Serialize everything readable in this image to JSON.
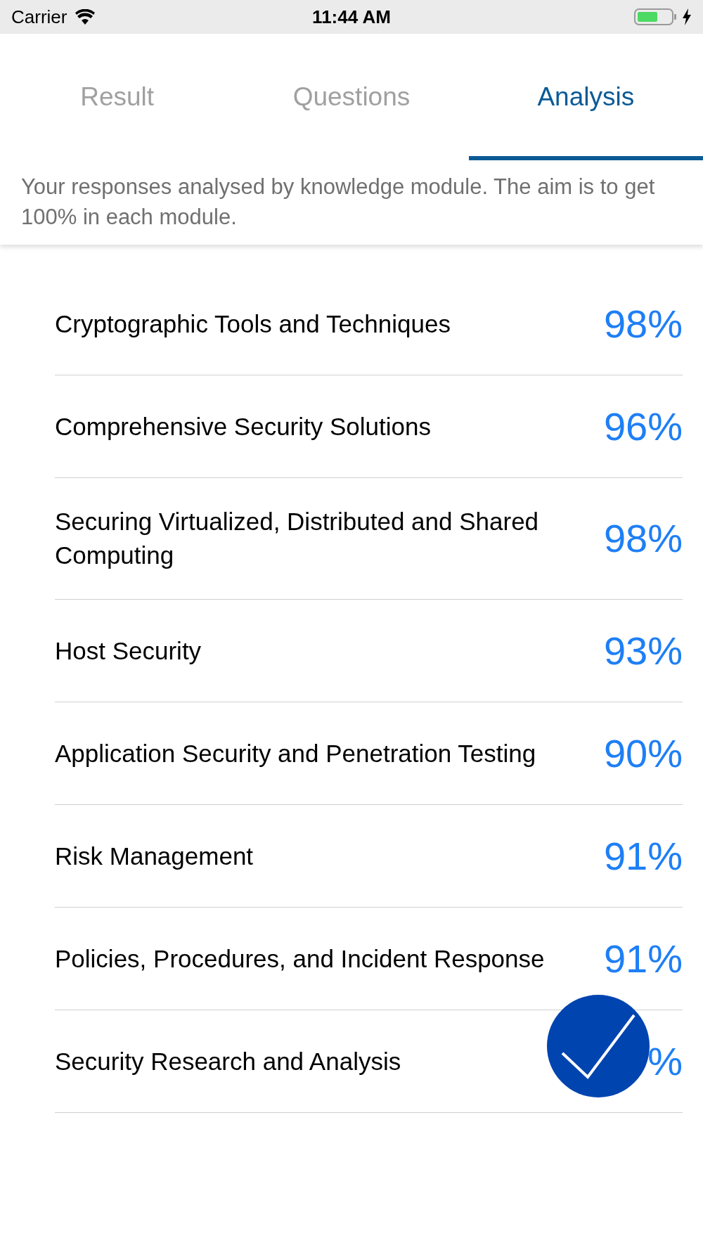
{
  "status_bar": {
    "carrier": "Carrier",
    "time": "11:44 AM"
  },
  "tabs": [
    {
      "label": "Result",
      "selected": false
    },
    {
      "label": "Questions",
      "selected": false
    },
    {
      "label": "Analysis",
      "selected": true
    }
  ],
  "description": "Your responses analysed by knowledge module. The aim is to get 100% in each module.",
  "modules": [
    {
      "name": "Cryptographic Tools and Techniques",
      "score": "98%"
    },
    {
      "name": "Comprehensive Security Solutions",
      "score": "96%"
    },
    {
      "name": "Securing Virtualized, Distributed and Shared Computing",
      "score": "98%"
    },
    {
      "name": "Host Security",
      "score": "93%"
    },
    {
      "name": "Application Security and Penetration Testing",
      "score": "90%"
    },
    {
      "name": "Risk Management",
      "score": "91%"
    },
    {
      "name": "Policies, Procedures, and Incident Response",
      "score": "91%"
    },
    {
      "name": "Security Research and Analysis",
      "score": "%"
    }
  ]
}
